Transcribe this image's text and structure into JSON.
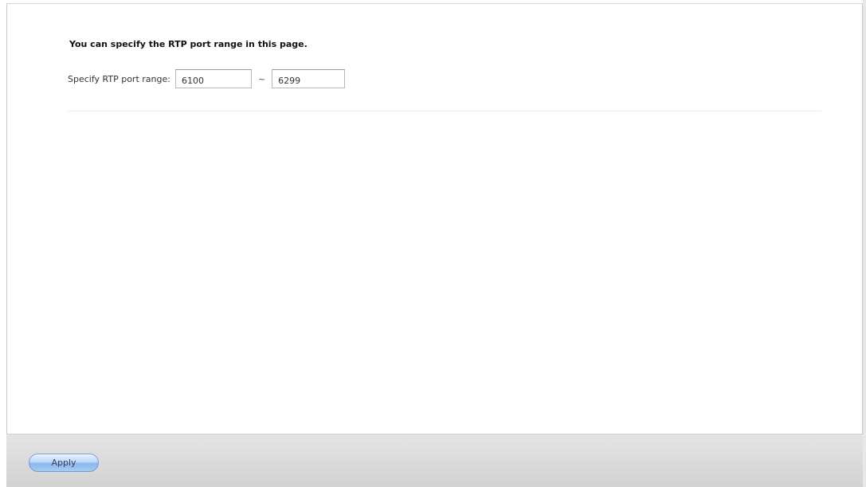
{
  "panel": {
    "heading": "You can specify the RTP port range in this page.",
    "rtp_range": {
      "label": "Specify RTP port range:",
      "start_value": "6100",
      "separator": "~",
      "end_value": "6299"
    }
  },
  "footer": {
    "apply_label": "Apply"
  },
  "colors": {
    "panel_background": "#ffffff",
    "footer_background": "#dcdcdc",
    "apply_button_accent": "#8ab7ec"
  }
}
